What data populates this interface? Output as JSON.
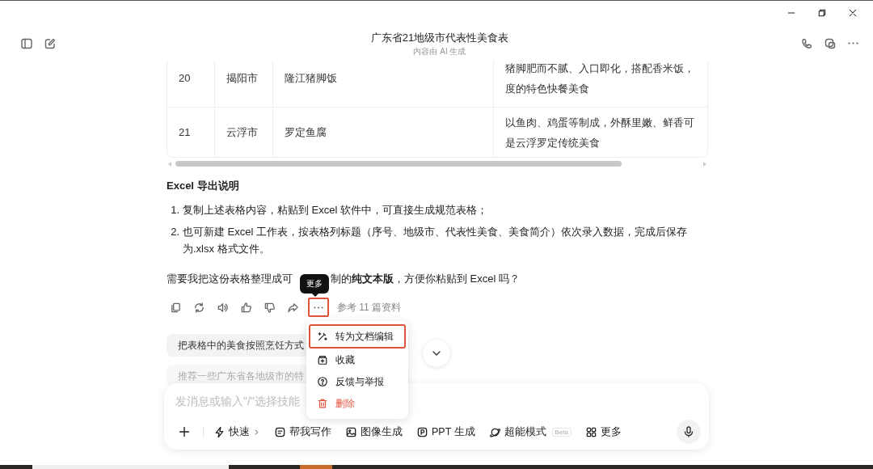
{
  "header": {
    "title": "广东省21地级市代表性美食表",
    "subtitle": "内容由 AI 生成"
  },
  "table": {
    "rows": [
      {
        "no": "20",
        "city": "揭阳市",
        "food": "隆江猪脚饭",
        "description": [
          "猪脚肥而不腻、入口即化，搭配香米饭，",
          "度的特色快餐美食"
        ]
      },
      {
        "no": "21",
        "city": "云浮市",
        "food": "罗定鱼腐",
        "description": [
          "以鱼肉、鸡蛋等制成，外酥里嫩、鲜香可",
          "是云浮罗定传统美食"
        ]
      }
    ]
  },
  "export": {
    "heading": "Excel 导出说明",
    "steps": [
      {
        "number": "1.",
        "text": "复制上述表格内容，粘贴到 Excel 软件中，可直接生成规范表格；"
      },
      {
        "number": "2.",
        "text": "也可新建 Excel 工作表，按表格列标题（序号、地级市、代表性美食、美食简介）依次录入数据，完成后保存为.xlsx 格式文件。"
      }
    ]
  },
  "question": {
    "before": "需要我把这份表格整理成可",
    "after": "制的**纯文本版**，方便你粘贴到 Excel 吗？"
  },
  "actions": {
    "more_highlighted": true,
    "tooltip": "更多",
    "sources": "参考 11 篇资料"
  },
  "suggestions": [
    {
      "text": "把表格中的美食按照烹饪方式",
      "faded": false
    },
    {
      "text": "推荐一些广东省各地级市的特",
      "faded": true
    }
  ],
  "menu": {
    "items": [
      {
        "kind": "convert",
        "label": "转为文档编辑",
        "highlighted": true,
        "danger": false
      },
      {
        "kind": "favorite",
        "label": "收藏",
        "highlighted": false,
        "danger": false
      },
      {
        "kind": "feedback",
        "label": "反馈与举报",
        "highlighted": false,
        "danger": false
      },
      {
        "kind": "delete",
        "label": "删除",
        "highlighted": false,
        "danger": true
      }
    ]
  },
  "composer": {
    "placeholder": "发消息或输入\"/\"选择技能",
    "tools": [
      {
        "kind": "quick",
        "label": "快速"
      },
      {
        "kind": "write",
        "label": "帮我写作"
      },
      {
        "kind": "image",
        "label": "图像生成"
      },
      {
        "kind": "ppt",
        "label": "PPT 生成"
      },
      {
        "kind": "super",
        "label": "超能模式",
        "badge": "Beta"
      },
      {
        "kind": "more",
        "label": "更多"
      }
    ]
  }
}
